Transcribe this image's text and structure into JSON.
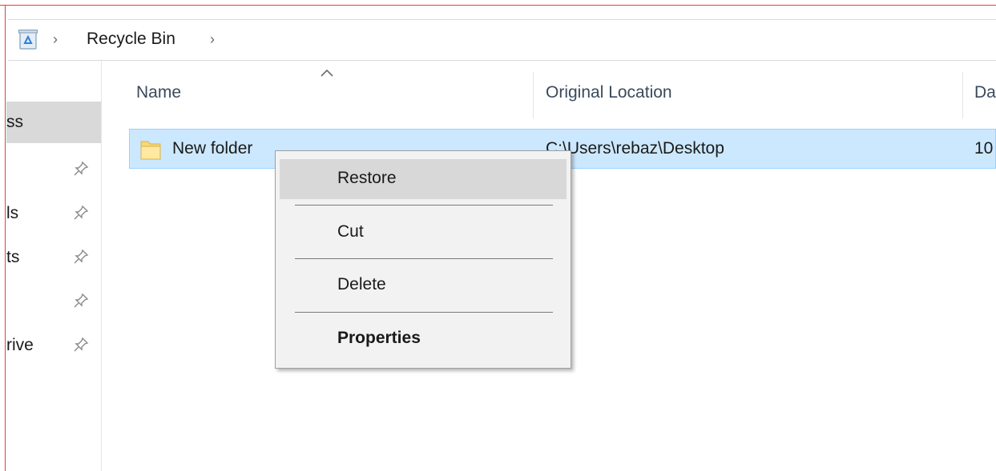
{
  "window": {
    "frame_color": "#e0403a"
  },
  "address_bar": {
    "icon": "recycle-bin-icon",
    "separator": "›",
    "location": "Recycle Bin"
  },
  "navigation": {
    "items": [
      {
        "label": "ss",
        "pinned": false,
        "selected": true
      },
      {
        "label": "",
        "pinned": true,
        "selected": false
      },
      {
        "label": "ls",
        "pinned": true,
        "selected": false
      },
      {
        "label": "ts",
        "pinned": true,
        "selected": false
      },
      {
        "label": "",
        "pinned": true,
        "selected": false
      },
      {
        "label": "rive",
        "pinned": true,
        "selected": false
      }
    ],
    "pin_icon": "pin-icon"
  },
  "columns": {
    "name": "Name",
    "original_location": "Original Location",
    "date_deleted": "Da",
    "sort_indicator": "^"
  },
  "files": [
    {
      "name": "New folder",
      "original_location": "C:\\Users\\rebaz\\Desktop",
      "date_deleted": "10",
      "selected": true,
      "icon": "folder-icon"
    }
  ],
  "context_menu": {
    "restore": "Restore",
    "cut": "Cut",
    "delete": "Delete",
    "properties": "Properties",
    "highlighted": "Restore"
  },
  "colors": {
    "selection_bg": "#cce8ff",
    "selection_border": "#99d1ff",
    "menu_bg": "#f2f2f2",
    "menu_highlight": "#d8d8d8",
    "nav_selected": "#d9d9d9"
  }
}
